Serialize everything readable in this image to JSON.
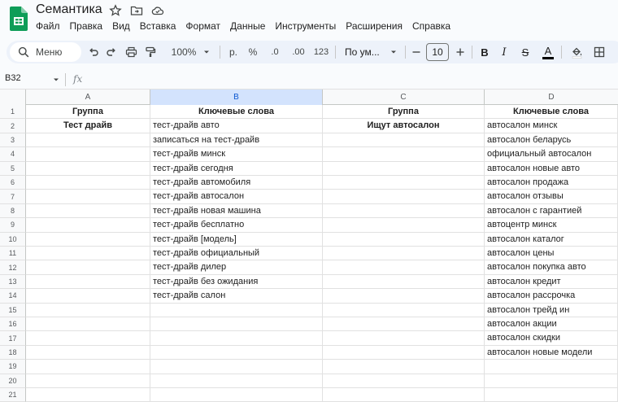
{
  "app": {
    "title": "Семантика",
    "menu": [
      "Файл",
      "Правка",
      "Вид",
      "Вставка",
      "Формат",
      "Данные",
      "Инструменты",
      "Расширения",
      "Справка"
    ]
  },
  "toolbar": {
    "menu_search": "Меню",
    "zoom": "100%",
    "format_rub": "р.",
    "format_percent": "%",
    "decrease_decimal": ".0",
    "increase_decimal": ".00",
    "format_more": "123",
    "font": "По ум...",
    "font_size": "10",
    "bold": "B",
    "italic": "I",
    "strike": "S",
    "text_color": "A"
  },
  "formula_bar": {
    "name_box": "B32",
    "fx": "fx"
  },
  "sheet": {
    "columns": [
      "A",
      "B",
      "C",
      "D"
    ],
    "selected_column": "B",
    "rows": [
      {
        "n": "1",
        "a": "Группа",
        "b": "Ключевые слова",
        "c": "Группа",
        "d": "Ключевые слова"
      },
      {
        "n": "2",
        "a": "Тест драйв",
        "b": "тест-драйв авто",
        "c": "Ищут автосалон",
        "d": "автосалон минск"
      },
      {
        "n": "3",
        "a": "",
        "b": "записаться на тест-драйв",
        "c": "",
        "d": "автосалон беларусь"
      },
      {
        "n": "4",
        "a": "",
        "b": "тест-драйв минск",
        "c": "",
        "d": "официальный автосалон"
      },
      {
        "n": "5",
        "a": "",
        "b": "тест-драйв сегодня",
        "c": "",
        "d": "автосалон новые авто"
      },
      {
        "n": "6",
        "a": "",
        "b": "тест-драйв автомобиля",
        "c": "",
        "d": "автосалон продажа"
      },
      {
        "n": "7",
        "a": "",
        "b": "тест-драйв автосалон",
        "c": "",
        "d": "автосалон отзывы"
      },
      {
        "n": "8",
        "a": "",
        "b": "тест-драйв новая машина",
        "c": "",
        "d": "автосалон с гарантией"
      },
      {
        "n": "9",
        "a": "",
        "b": "тест-драйв бесплатно",
        "c": "",
        "d": "автоцентр минск"
      },
      {
        "n": "10",
        "a": "",
        "b": "тест-драйв [модель]",
        "c": "",
        "d": "автосалон каталог"
      },
      {
        "n": "11",
        "a": "",
        "b": "тест-драйв официальный",
        "c": "",
        "d": "автосалон цены"
      },
      {
        "n": "12",
        "a": "",
        "b": "тест-драйв дилер",
        "c": "",
        "d": "автосалон покупка авто"
      },
      {
        "n": "13",
        "a": "",
        "b": "тест-драйв без ожидания",
        "c": "",
        "d": "автосалон кредит"
      },
      {
        "n": "14",
        "a": "",
        "b": "тест-драйв салон",
        "c": "",
        "d": "автосалон рассрочка"
      },
      {
        "n": "15",
        "a": "",
        "b": "",
        "c": "",
        "d": "автосалон трейд ин"
      },
      {
        "n": "16",
        "a": "",
        "b": "",
        "c": "",
        "d": "автосалон акции"
      },
      {
        "n": "17",
        "a": "",
        "b": "",
        "c": "",
        "d": "автосалон скидки"
      },
      {
        "n": "18",
        "a": "",
        "b": "",
        "c": "",
        "d": "автосалон новые модели"
      },
      {
        "n": "19",
        "a": "",
        "b": "",
        "c": "",
        "d": ""
      },
      {
        "n": "20",
        "a": "",
        "b": "",
        "c": "",
        "d": ""
      },
      {
        "n": "21",
        "a": "",
        "b": "",
        "c": "",
        "d": ""
      }
    ]
  },
  "colors": {
    "brand_green": "#0f9d58",
    "selected_header": "#d3e3fd",
    "toolbar_bg": "#edf2fa"
  }
}
